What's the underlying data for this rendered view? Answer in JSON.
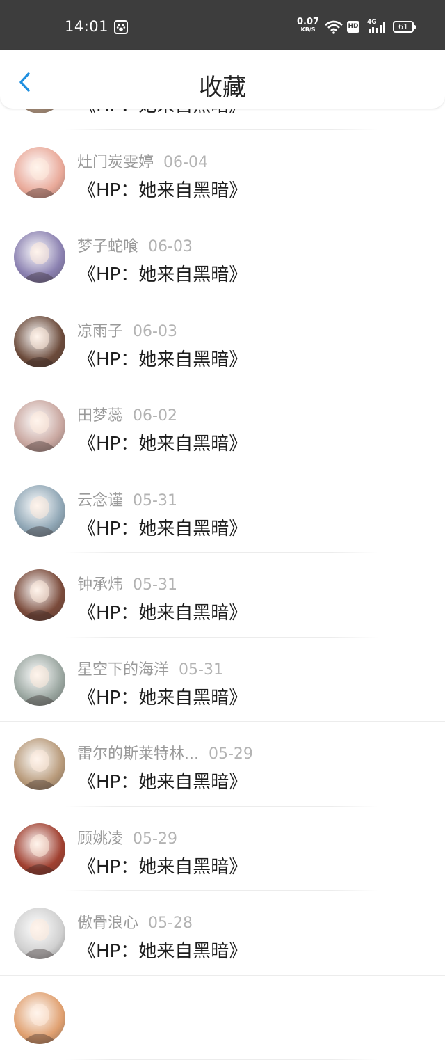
{
  "status_bar": {
    "time": "14:01",
    "speed_value": "0.07",
    "speed_unit": "KB/S",
    "hd": "HD",
    "network": "4G",
    "battery": "61"
  },
  "header": {
    "title": "收藏",
    "back_icon": "chevron-left-icon"
  },
  "accent_color": "#1e8fe0",
  "items": [
    {
      "user": "",
      "date": "",
      "book": "《HP：她来自黑暗》",
      "avatar_color": "#e8c8a8"
    },
    {
      "user": "灶门炭雯婷",
      "date": "06-04",
      "book": "《HP：她来自黑暗》",
      "avatar_color": "#e9a999"
    },
    {
      "user": "梦子蛇喰",
      "date": "06-03",
      "book": "《HP：她来自黑暗》",
      "avatar_color": "#8a80b0"
    },
    {
      "user": "凉雨子",
      "date": "06-03",
      "book": "《HP：她来自黑暗》",
      "avatar_color": "#6b4a3a"
    },
    {
      "user": "田梦蕊",
      "date": "06-02",
      "book": "《HP：她来自黑暗》",
      "avatar_color": "#c9a7a0"
    },
    {
      "user": "云念谨",
      "date": "05-31",
      "book": "《HP：她来自黑暗》",
      "avatar_color": "#8fa6b5"
    },
    {
      "user": "钟承炜",
      "date": "05-31",
      "book": "《HP：她来自黑暗》",
      "avatar_color": "#7a4a3a"
    },
    {
      "user": "星空下的海洋",
      "date": "05-31",
      "book": "《HP：她来自黑暗》",
      "avatar_color": "#9aa6a0"
    },
    {
      "user": "雷尔的斯莱特林...",
      "date": "05-29",
      "book": "《HP：她来自黑暗》",
      "avatar_color": "#b89a7a"
    },
    {
      "user": "顾姚凌",
      "date": "05-29",
      "book": "《HP：她来自黑暗》",
      "avatar_color": "#a04030"
    },
    {
      "user": "傲骨浪心",
      "date": "05-28",
      "book": "《HP：她来自黑暗》",
      "avatar_color": "#d0d0d0"
    },
    {
      "user": "",
      "date": "",
      "book": "",
      "avatar_color": "#e0a070"
    }
  ]
}
